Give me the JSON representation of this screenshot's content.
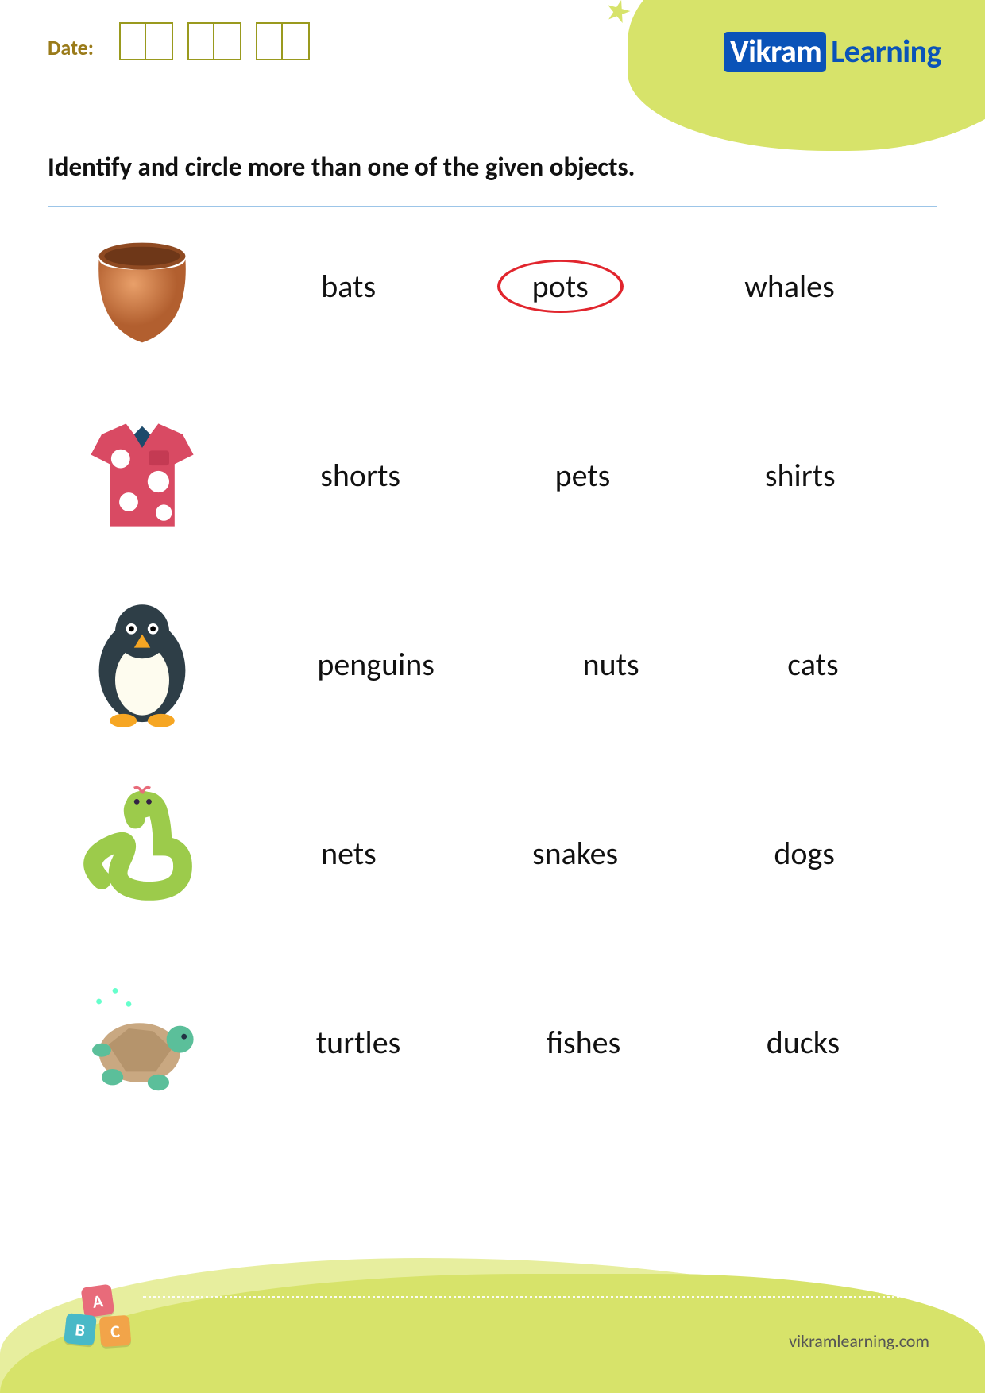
{
  "header": {
    "date_label": "Date:",
    "brand_boxed": "Vikram",
    "brand_rest": "Learning"
  },
  "instruction": "Identify and circle more than one of the given objects.",
  "rows": [
    {
      "image": "pot-icon",
      "options": [
        {
          "text": "bats",
          "circled": false
        },
        {
          "text": "pots",
          "circled": true
        },
        {
          "text": "whales",
          "circled": false
        }
      ]
    },
    {
      "image": "shirt-icon",
      "options": [
        {
          "text": "shorts",
          "circled": false
        },
        {
          "text": "pets",
          "circled": false
        },
        {
          "text": "shirts",
          "circled": false
        }
      ]
    },
    {
      "image": "penguin-icon",
      "options": [
        {
          "text": "penguins",
          "circled": false
        },
        {
          "text": "nuts",
          "circled": false
        },
        {
          "text": "cats",
          "circled": false
        }
      ]
    },
    {
      "image": "snake-icon",
      "options": [
        {
          "text": "nets",
          "circled": false
        },
        {
          "text": "snakes",
          "circled": false
        },
        {
          "text": "dogs",
          "circled": false
        }
      ]
    },
    {
      "image": "turtle-icon",
      "options": [
        {
          "text": "turtles",
          "circled": false
        },
        {
          "text": "fishes",
          "circled": false
        },
        {
          "text": "ducks",
          "circled": false
        }
      ]
    }
  ],
  "footer": {
    "url": "vikramlearning.com",
    "badge_letters": [
      "A",
      "B",
      "C"
    ]
  }
}
